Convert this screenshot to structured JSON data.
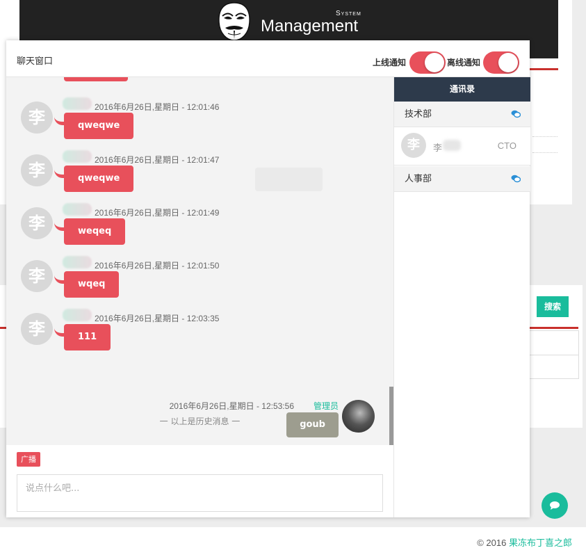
{
  "header": {
    "brand": "Management",
    "brand_small": "System"
  },
  "background": {
    "search_button": "搜索",
    "footer_copyright": "© 2016",
    "footer_link": "果冻布丁喜之郎"
  },
  "chat": {
    "title": "聊天窗口",
    "online_notify_label": "上线通知",
    "offline_notify_label": "离线通知",
    "online_notify_on": true,
    "offline_notify_on": true,
    "messages": [
      {
        "avatar": "李",
        "time": "2016年6月26日,星期日 - 12:01:46",
        "text": "qweqwe"
      },
      {
        "avatar": "李",
        "time": "2016年6月26日,星期日 - 12:01:47",
        "text": "qweqwe"
      },
      {
        "avatar": "李",
        "time": "2016年6月26日,星期日 - 12:01:49",
        "text": "weqeq"
      },
      {
        "avatar": "李",
        "time": "2016年6月26日,星期日 - 12:01:50",
        "text": "wqeq"
      },
      {
        "avatar": "李",
        "time": "2016年6月26日,星期日 - 12:03:35",
        "text": "111"
      }
    ],
    "self_message": {
      "time": "2016年6月26日,星期日 - 12:53:56",
      "role": "管理员",
      "text": "goub"
    },
    "history_tip": "一  以上是历史消息  一",
    "broadcast_button": "广播",
    "input_placeholder": "说点什么吧..."
  },
  "contacts": {
    "title": "通讯录",
    "groups": [
      {
        "name": "技术部"
      },
      {
        "name": "人事部"
      }
    ],
    "members": [
      {
        "avatar": "李",
        "name": "李",
        "title": "CTO"
      }
    ]
  },
  "colors": {
    "accent_red": "#e8505b",
    "teal": "#1abc9c",
    "dark_header": "#2d3a4b",
    "self_bubble": "#9d9d8f"
  },
  "icons": [
    "chat-bubbles-icon",
    "chat-fab-icon",
    "mask-logo-icon"
  ]
}
